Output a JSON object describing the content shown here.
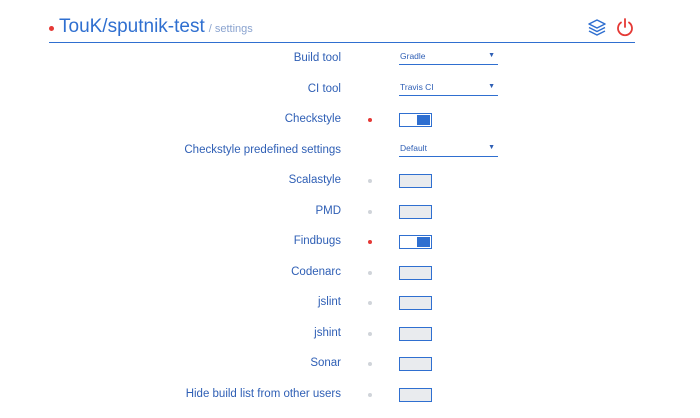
{
  "header": {
    "title": "TouK/sputnik-test",
    "subtitle": "/ settings",
    "icons": [
      "layers-icon",
      "power-icon"
    ],
    "accent": "#2f6fd0",
    "status_color": "#e53935"
  },
  "settings": [
    {
      "label": "Build tool",
      "type": "select",
      "value": "Gradle"
    },
    {
      "label": "CI tool",
      "type": "select",
      "value": "Travis CI"
    },
    {
      "label": "Checkstyle",
      "type": "toggle",
      "on": true
    },
    {
      "label": "Checkstyle predefined settings",
      "type": "select",
      "value": "Default"
    },
    {
      "label": "Scalastyle",
      "type": "toggle",
      "on": false
    },
    {
      "label": "PMD",
      "type": "toggle",
      "on": false
    },
    {
      "label": "Findbugs",
      "type": "toggle",
      "on": true
    },
    {
      "label": "Codenarc",
      "type": "toggle",
      "on": false
    },
    {
      "label": "jslint",
      "type": "toggle",
      "on": false
    },
    {
      "label": "jshint",
      "type": "toggle",
      "on": false
    },
    {
      "label": "Sonar",
      "type": "toggle",
      "on": false
    },
    {
      "label": "Hide build list from other users",
      "type": "toggle",
      "on": false
    }
  ]
}
